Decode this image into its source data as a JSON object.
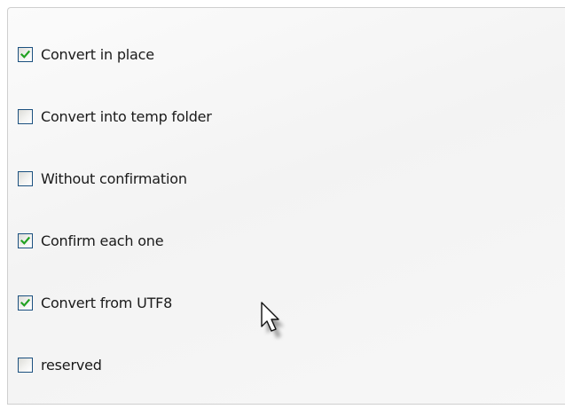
{
  "options": [
    {
      "label": "Convert in place",
      "checked": true
    },
    {
      "label": "Convert into temp folder",
      "checked": false
    },
    {
      "label": "Without confirmation",
      "checked": false
    },
    {
      "label": "Confirm each one",
      "checked": true
    },
    {
      "label": "Convert from UTF8",
      "checked": true
    },
    {
      "label": "reserved",
      "checked": false
    }
  ],
  "colors": {
    "checkbox_border": "#1c5180",
    "checkmark": "#21a121",
    "label_text": "#1a1a1a"
  },
  "icons": {
    "checkmark": "checkmark-icon",
    "cursor": "mouse-pointer-icon"
  }
}
